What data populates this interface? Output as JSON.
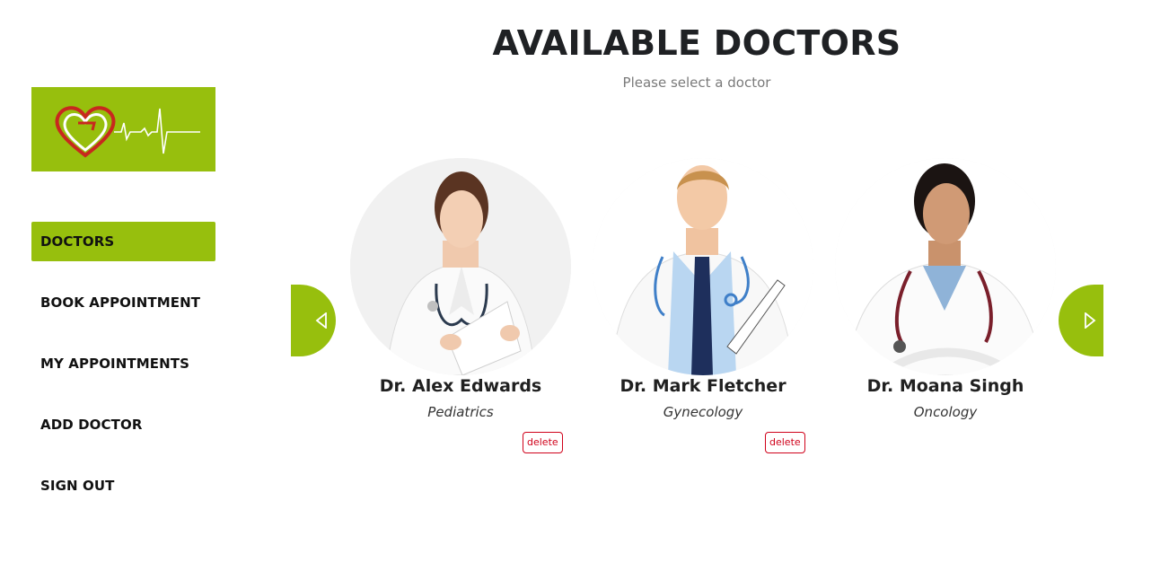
{
  "header": {
    "title": "AVAILABLE DOCTORS",
    "subtitle": "Please select a doctor"
  },
  "sidebar": {
    "items": [
      {
        "label": "DOCTORS",
        "active": true
      },
      {
        "label": "BOOK APPOINTMENT",
        "active": false
      },
      {
        "label": "MY APPOINTMENTS",
        "active": false
      },
      {
        "label": "ADD DOCTOR",
        "active": false
      },
      {
        "label": "SIGN OUT",
        "active": false
      }
    ]
  },
  "doctors": [
    {
      "name": "Dr. Alex Edwards",
      "specialty": "Pediatrics",
      "delete_label": "delete"
    },
    {
      "name": "Dr. Mark Fletcher",
      "specialty": "Gynecology",
      "delete_label": "delete"
    },
    {
      "name": "Dr. Moana Singh",
      "specialty": "Oncology"
    }
  ],
  "carousel": {
    "prev_icon": "triangle-left-icon",
    "next_icon": "triangle-right-icon"
  },
  "colors": {
    "accent": "#97bf0d",
    "delete": "#d0021b",
    "title": "#1f2124"
  }
}
